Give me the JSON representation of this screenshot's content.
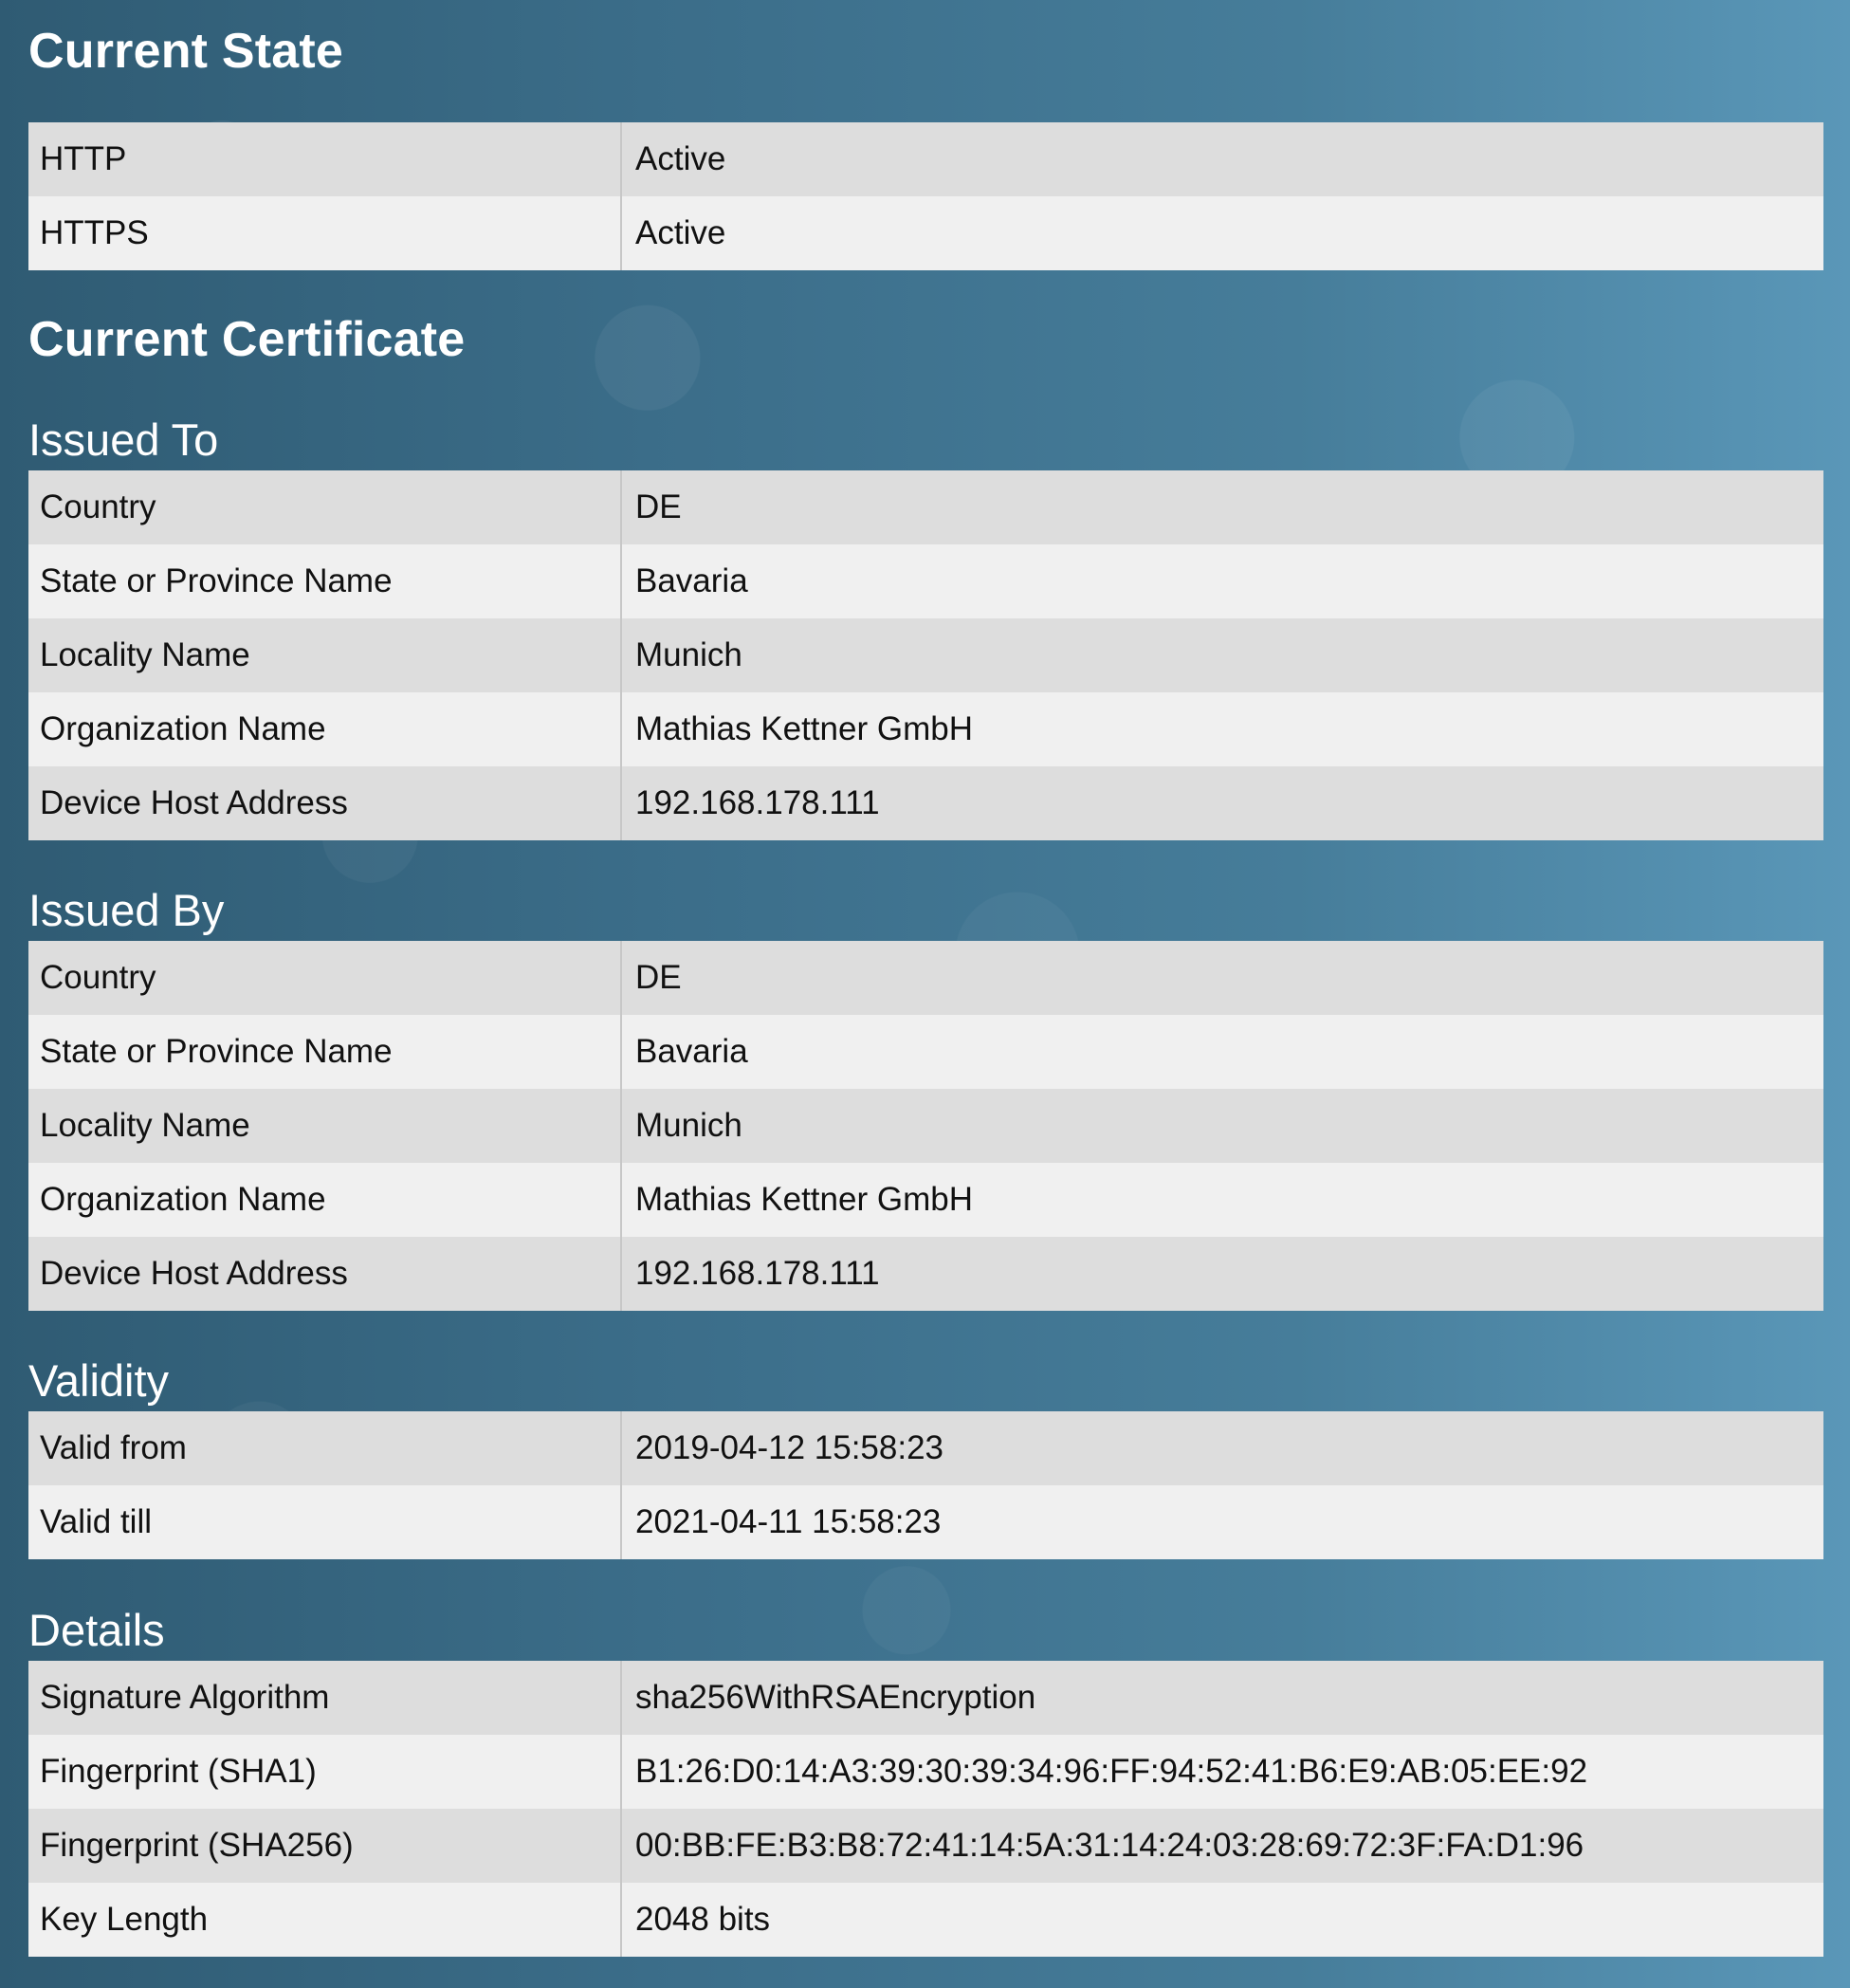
{
  "current_state": {
    "title": "Current State",
    "rows": [
      {
        "key": "HTTP",
        "value": "Active"
      },
      {
        "key": "HTTPS",
        "value": "Active"
      }
    ]
  },
  "current_certificate": {
    "title": "Current Certificate",
    "issued_to": {
      "title": "Issued To",
      "rows": [
        {
          "key": "Country",
          "value": "DE"
        },
        {
          "key": "State or Province Name",
          "value": "Bavaria"
        },
        {
          "key": "Locality Name",
          "value": "Munich"
        },
        {
          "key": "Organization Name",
          "value": "Mathias Kettner GmbH"
        },
        {
          "key": "Device Host Address",
          "value": "192.168.178.111"
        }
      ]
    },
    "issued_by": {
      "title": "Issued By",
      "rows": [
        {
          "key": "Country",
          "value": "DE"
        },
        {
          "key": "State or Province Name",
          "value": "Bavaria"
        },
        {
          "key": "Locality Name",
          "value": "Munich"
        },
        {
          "key": "Organization Name",
          "value": "Mathias Kettner GmbH"
        },
        {
          "key": "Device Host Address",
          "value": "192.168.178.111"
        }
      ]
    },
    "validity": {
      "title": "Validity",
      "rows": [
        {
          "key": "Valid from",
          "value": "2019-04-12 15:58:23"
        },
        {
          "key": "Valid till",
          "value": "2021-04-11 15:58:23"
        }
      ]
    },
    "details": {
      "title": "Details",
      "rows": [
        {
          "key": "Signature Algorithm",
          "value": "sha256WithRSAEncryption"
        },
        {
          "key": "Fingerprint (SHA1)",
          "value": "B1:26:D0:14:A3:39:30:39:34:96:FF:94:52:41:B6:E9:AB:05:EE:92"
        },
        {
          "key": "Fingerprint (SHA256)",
          "value": "00:BB:FE:B3:B8:72:41:14:5A:31:14:24:03:28:69:72:3F:FA:D1:96"
        },
        {
          "key": "Key Length",
          "value": "2048 bits"
        }
      ]
    }
  }
}
